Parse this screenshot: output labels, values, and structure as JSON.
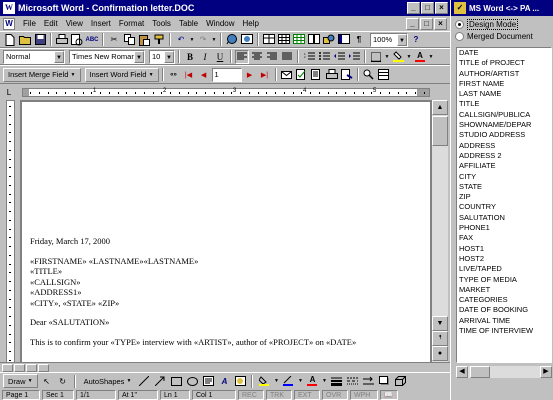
{
  "word": {
    "title": "Microsoft Word - Confirmation letter.DOC",
    "window_buttons": [
      "_",
      "□",
      "×"
    ],
    "doc_buttons": [
      "_",
      "□",
      "×"
    ],
    "menu": [
      "File",
      "Edit",
      "View",
      "Insert",
      "Format",
      "Tools",
      "Table",
      "Window",
      "Help"
    ],
    "standard_toolbar": {
      "zoom": "100%"
    },
    "formatting_toolbar": {
      "style": "Normal",
      "font": "Times New Roman",
      "size": "10"
    },
    "mail_merge_toolbar": {
      "insert_merge_field": "Insert Merge Field",
      "insert_word_field": "Insert Word Field",
      "record_number": "1"
    },
    "ruler_numbers": [
      "1",
      "2",
      "3",
      "4",
      "5"
    ],
    "document_lines": [
      "Friday, March 17, 2000",
      "",
      "«FIRSTNAME» «LASTNAME»«LASTNAME»",
      "«TITLE»",
      "«CALLSIGN»",
      "«ADDRESS1»",
      "«CITY», «STATE» «ZIP»",
      "",
      "Dear «SALUTATION»",
      "",
      "This is to confirm your «TYPE» interview with «ARTIST», author of «PROJECT» on «DATE»"
    ],
    "draw_toolbar": {
      "draw_label": "Draw",
      "autoshapes_label": "AutoShapes"
    },
    "status_bar": {
      "page": "Page 1",
      "section": "Sec 1",
      "pages": "1/1",
      "at": "At 1\"",
      "line": "Ln 1",
      "col": "Col 1",
      "modes": [
        "REC",
        "TRK",
        "EXT",
        "OVR",
        "WPH"
      ]
    }
  },
  "pa": {
    "title": "MS Word <-> PA ...",
    "mode_design": "Design Mode",
    "mode_merged": "Merged Document",
    "fields": [
      "DATE",
      "TITLE of PROJECT",
      "AUTHOR/ARTIST",
      "FIRST NAME",
      "LAST NAME",
      "TITLE",
      "CALLSIGN/PUBLICA",
      "SHOWNAME/DEPAR",
      "STUDIO ADDRESS",
      "ADDRESS",
      "ADDRESS 2",
      "AFFILIATE",
      "CITY",
      "STATE",
      "ZIP",
      "COUNTRY",
      "SALUTATION",
      "PHONE1",
      "FAX",
      "HOST1",
      "HOST2",
      "LIVE/TAPED",
      "TYPE OF MEDIA",
      "MARKET",
      "CATEGORIES",
      "DATE OF BOOKING",
      "ARRIVAL TIME",
      "TIME OF INTERVIEW"
    ]
  }
}
